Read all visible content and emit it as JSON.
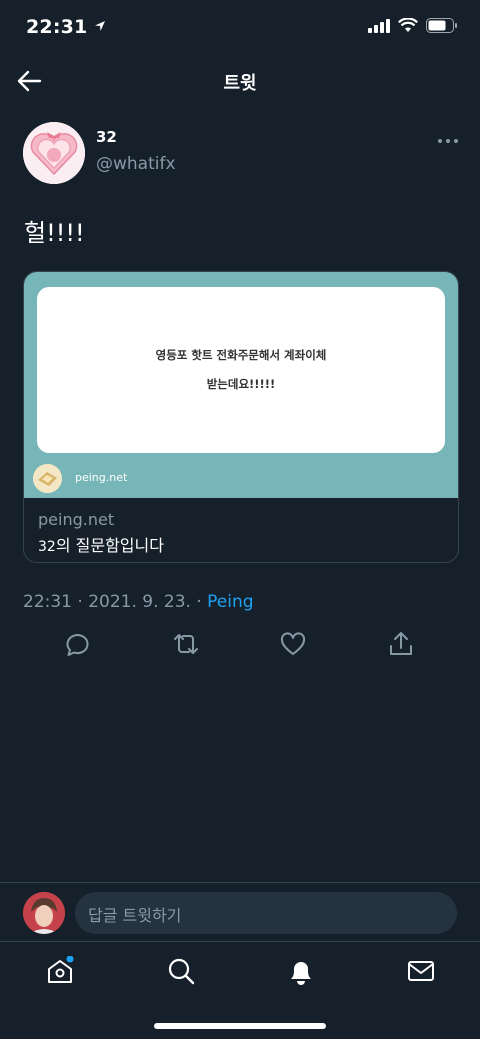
{
  "status_bar": {
    "time": "22:31"
  },
  "header": {
    "title": "트윗"
  },
  "tweet": {
    "author_name": "32",
    "author_handle": "@whatifx",
    "text": "헐!!!!",
    "meta_time": "22:31 · 2021. 9. 23. · ",
    "source": "Peing"
  },
  "card": {
    "question_line1": "영등포 핫트 전화주문해서 계좌이체",
    "question_line2": "받는데요!!!!!",
    "site_label": "peing.net",
    "domain": "peing.net",
    "title_prefix": "32",
    "title_rest": "의 질문함입니다"
  },
  "reply": {
    "placeholder": "답글 트윗하기"
  },
  "colors": {
    "background": "#15202b",
    "accent": "#1da1f2",
    "card_bg": "#77b6b8",
    "muted": "#8899a6"
  },
  "icons": [
    "back-arrow-icon",
    "more-icon",
    "reply-icon",
    "retweet-icon",
    "like-icon",
    "share-icon",
    "home-icon",
    "search-icon",
    "notifications-icon",
    "messages-icon"
  ]
}
